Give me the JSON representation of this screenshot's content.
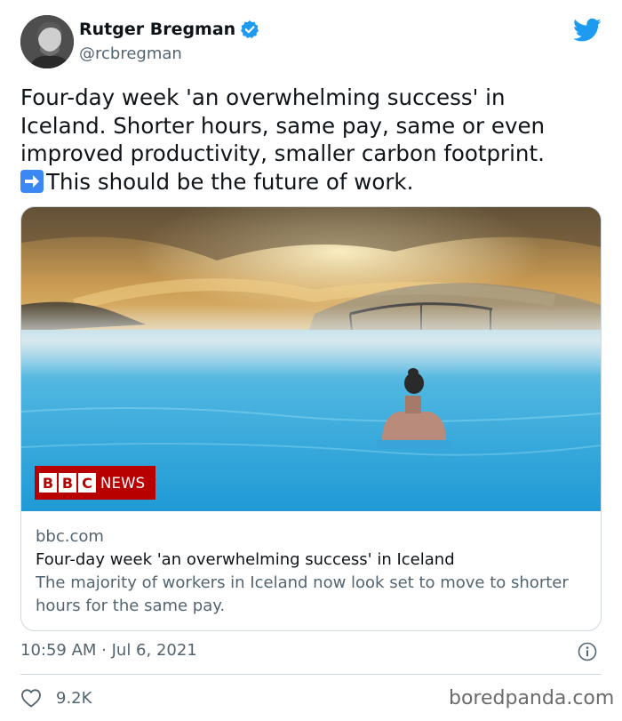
{
  "user": {
    "name": "Rutger Bregman",
    "handle": "@rcbregman",
    "verified_color": "#1d9bf0"
  },
  "brand": {
    "logo_icon": "twitter-bird-icon",
    "logo_color": "#1d9bf0"
  },
  "tweet": {
    "text_line": "Four-day week 'an overwhelming success' in Iceland. Shorter hours, same pay, same or even improved productivity, smaller carbon footprint.",
    "emoji_icon": "right-arrow-emoji",
    "text_line_2": "This should be the future of work."
  },
  "card": {
    "badge_letters": [
      "B",
      "B",
      "C"
    ],
    "badge_word": "NEWS",
    "domain": "bbc.com",
    "title": "Four-day week 'an overwhelming success' in Iceland",
    "description": "The majority of workers in Iceland now look set to move to shorter hours for the same pay."
  },
  "meta": {
    "timestamp": "10:59 AM · Jul 6, 2021",
    "info_icon": "info-icon"
  },
  "actions": {
    "like_icon": "heart-icon",
    "like_count": "9.2K"
  },
  "watermark": "boredpanda.com"
}
